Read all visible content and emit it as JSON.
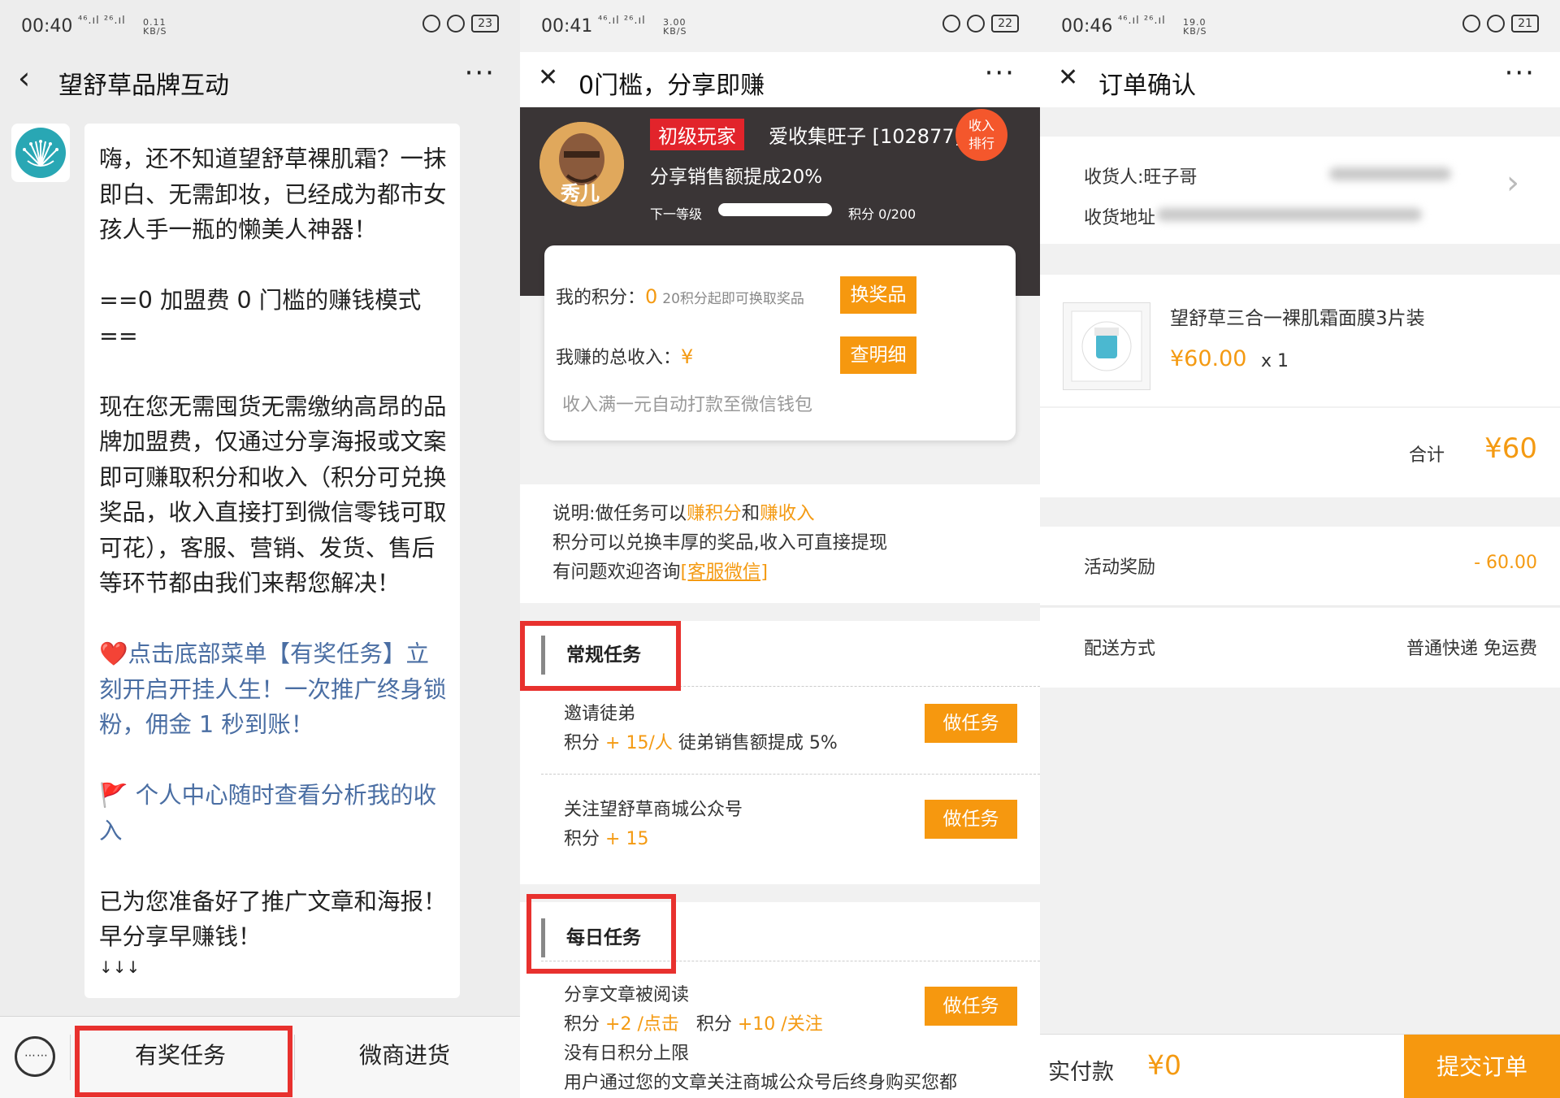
{
  "panel1": {
    "status": {
      "time": "00:40",
      "signal": "⁴⁶.ıl ²⁶.ıl",
      "speed": "0.11 KB/S",
      "battery": "23"
    },
    "nav": {
      "back_icon": "chevron-left-icon",
      "title": "望舒草品牌互动",
      "more": "···"
    },
    "message": {
      "intro": "嗨，还不知道望舒草裸肌霜？一抹即白、无需卸妆，已经成为都市女孩人手一瓶的懒美人神器！",
      "mode": "==0 加盟费 0 门槛的赚钱模式==",
      "body": "现在您无需囤货无需缴纳高昂的品牌加盟费，仅通过分享海报或文案即可赚取积分和收入（积分可兑换奖品，收入直接打到微信零钱可取可花），客服、营销、发货、售后等环节都由我们来帮您解决！",
      "heart_emoji": "❤️",
      "cta": "点击底部菜单【有奖任务】立刻开启开挂人生！一次推广终身锁粉，佣金 1 秒到账！",
      "flag_emoji": "🚩",
      "center": "个人中心随时查看分析我的收入",
      "ready": "已为您准备好了推广文章和海报！早分享早赚钱！",
      "arrows": "↓↓↓"
    },
    "menu": {
      "keyboard_icon": "keyboard-icon",
      "keyboard_glyph": "⋯⋯",
      "item1": "有奖任务",
      "item2": "微商进货"
    }
  },
  "panel2": {
    "status": {
      "time": "00:41",
      "signal": "⁴⁶.ıl ²⁶.ıl",
      "speed": "3.00 KB/S",
      "battery": "22"
    },
    "nav": {
      "close": "✕",
      "title": "0门槛，分享即赚",
      "more": "···"
    },
    "profile": {
      "avatar_text": "秀儿",
      "level": "初级玩家",
      "nickname": "爱收集旺子 [102877]",
      "rank_line1": "收入",
      "rank_line2": "排行",
      "share_rate": "分享销售额提成20%",
      "next_level": "下一等级",
      "level_progress": 0,
      "points_level": "积分 0/200"
    },
    "card": {
      "points_label": "我的积分：",
      "points_value": "0",
      "points_hint": "20积分起即可换取奖品",
      "redeem_btn": "换奖品",
      "income_label": "我赚的总收入：",
      "income_currency": "¥",
      "detail_btn": "查明细",
      "note": "收入满一元自动打款至微信钱包"
    },
    "desc": {
      "line1_pre": "说明:做任务可以",
      "line1_a": "赚积分",
      "line1_mid": "和",
      "line1_b": "赚收入",
      "line2": "积分可以兑换丰厚的奖品,收入可直接提现",
      "line3_pre": "有问题欢迎咨询",
      "line3_link": "[客服微信]"
    },
    "regular": {
      "title": "常规任务",
      "tasks": [
        {
          "name": "邀请徒弟",
          "pts_label": "积分",
          "pts_value": "+ 15/人",
          "extra": "徒弟销售额提成 5%",
          "btn": "做任务"
        },
        {
          "name": "关注望舒草商城公众号",
          "pts_label": "积分",
          "pts_value": "+ 15",
          "btn": "做任务"
        }
      ]
    },
    "daily": {
      "title": "每日任务",
      "task": {
        "name": "分享文章被阅读",
        "pts_label": "积分",
        "pts_value1": "+2 /点击",
        "pts_label2": "积分",
        "pts_value2": "+10 /关注",
        "line3": "没有日积分上限",
        "line4": "用户通过您的文章关注商城公众号后终身购买您都",
        "btn": "做任务"
      }
    }
  },
  "panel3": {
    "status": {
      "time": "00:46",
      "signal": "⁴⁶.ıl ²⁶.ıl",
      "speed": "19.0 KB/S",
      "battery": "21"
    },
    "nav": {
      "close": "✕",
      "title": "订单确认",
      "more": "···"
    },
    "address": {
      "receiver": "收货人:旺子哥",
      "address_label": "收货地址",
      "chevron": "›"
    },
    "product": {
      "name": "望舒草三合一裸肌霜面膜3片装",
      "price": "¥60.00",
      "qty": "x 1"
    },
    "total": {
      "label": "合计",
      "value": "¥60"
    },
    "reward": {
      "label": "活动奖励",
      "value": "- 60.00"
    },
    "delivery": {
      "label": "配送方式",
      "value": "普通快递 免运费"
    },
    "footer": {
      "label": "实付款",
      "value": "¥0",
      "submit": "提交订单"
    }
  },
  "colors": {
    "accent": "#f6980f",
    "highlight_red": "#e8312e",
    "tag_red": "#e2242b",
    "dark_header": "#3a3536",
    "link_blue": "#4a6ea3"
  }
}
